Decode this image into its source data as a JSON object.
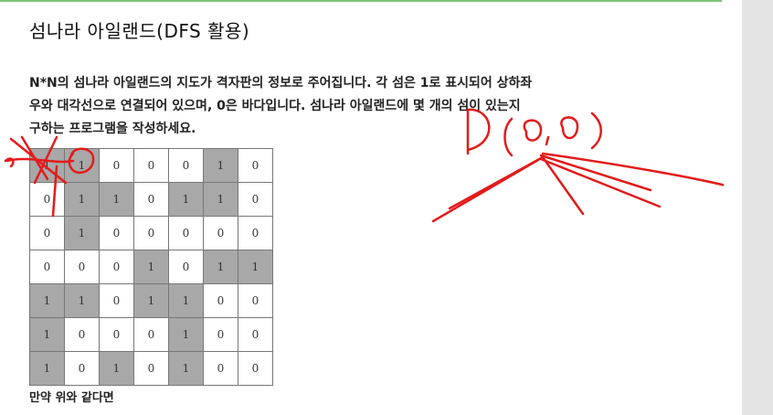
{
  "title": "섬나라 아일랜드(DFS 활용)",
  "description": {
    "line1": "N*N의 섬나라 아일랜드의 지도가 격자판의 정보로 주어집니다. 각 섬은 1로 표시되어 상하좌",
    "line2": "우와 대각선으로 연결되어 있으며, 0은 바다입니다. 섬나라 아일랜드에 몇 개의 섬이 있는지",
    "line3": "구하는 프로그램을 작성하세요."
  },
  "grid": [
    [
      "1",
      "1",
      "0",
      "0",
      "0",
      "1",
      "0"
    ],
    [
      "0",
      "1",
      "1",
      "0",
      "1",
      "1",
      "0"
    ],
    [
      "0",
      "1",
      "0",
      "0",
      "0",
      "0",
      "0"
    ],
    [
      "0",
      "0",
      "0",
      "1",
      "0",
      "1",
      "1"
    ],
    [
      "1",
      "1",
      "0",
      "1",
      "1",
      "0",
      "0"
    ],
    [
      "1",
      "0",
      "0",
      "0",
      "1",
      "0",
      "0"
    ],
    [
      "1",
      "0",
      "1",
      "0",
      "1",
      "0",
      "0"
    ]
  ],
  "footer": "만약 위와 같다면",
  "annotation": {
    "handwriting": "D(0, 0)",
    "ink_color": "#e31b1b"
  },
  "colors": {
    "land_cell": "#a8a8a8",
    "sea_cell": "#ffffff",
    "header_rule": "#7cc576"
  }
}
